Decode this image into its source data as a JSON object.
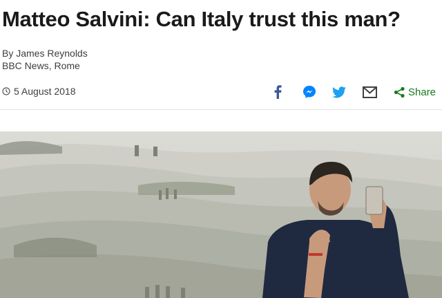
{
  "article": {
    "headline": "Matteo Salvini: Can Italy trust this man?",
    "byline_author": "By James Reynolds",
    "byline_location": "BBC News, Rome",
    "date": "5 August 2018"
  },
  "share": {
    "label": "Share",
    "icons": [
      "facebook-icon",
      "messenger-icon",
      "twitter-icon",
      "email-icon",
      "share-icon"
    ],
    "colors": {
      "facebook": "#3b5998",
      "messenger": "#0084ff",
      "twitter": "#1da1f2",
      "email": "#404040",
      "share": "#1a7a1a"
    }
  },
  "hero_image": {
    "subject": "photo-of-man-taking-selfie-in-front-of-tuscan-hills"
  }
}
